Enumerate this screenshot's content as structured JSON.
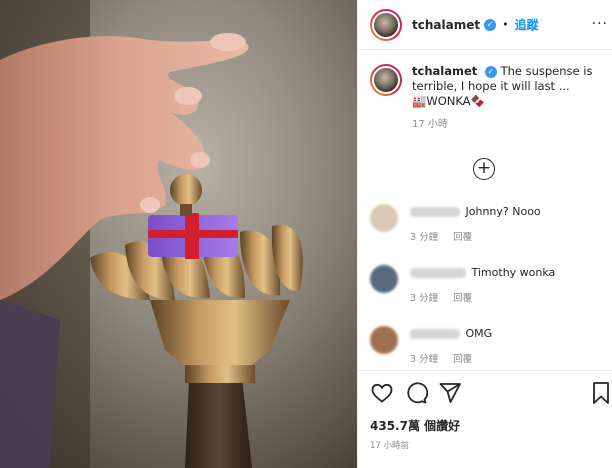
{
  "post": {
    "username": "tchalamet",
    "verified_mark": "✓",
    "separator": "•",
    "follow_label": "追蹤",
    "more_label": "···",
    "caption_text": "The suspense is terrible, I hope it will last ...",
    "caption_emoji_line": "🏭WONKA🍫",
    "caption_time": "17 小時",
    "load_more_label": "+",
    "likes_text": "435.7萬 個讚好",
    "posted_time": "17 小時前"
  },
  "comments": [
    {
      "text": "Johnny? Nooo",
      "time": "3 分鐘",
      "reply": "回覆",
      "avatar_color": "#d9c9b4"
    },
    {
      "text": "Timothy wonka",
      "time": "3 分鐘",
      "reply": "回覆",
      "avatar_color": "#5a6a7a"
    },
    {
      "text": "OMG",
      "time": "3 分鐘",
      "reply": "回覆",
      "avatar_color": "#a07050"
    }
  ],
  "icons": {
    "like": "heart-icon",
    "comment": "comment-icon",
    "share": "paper-plane-icon",
    "save": "bookmark-icon"
  },
  "colors": {
    "accent": "#0095f6",
    "verified": "#3897f0",
    "muted": "#8e8e8e",
    "text": "#262626"
  }
}
